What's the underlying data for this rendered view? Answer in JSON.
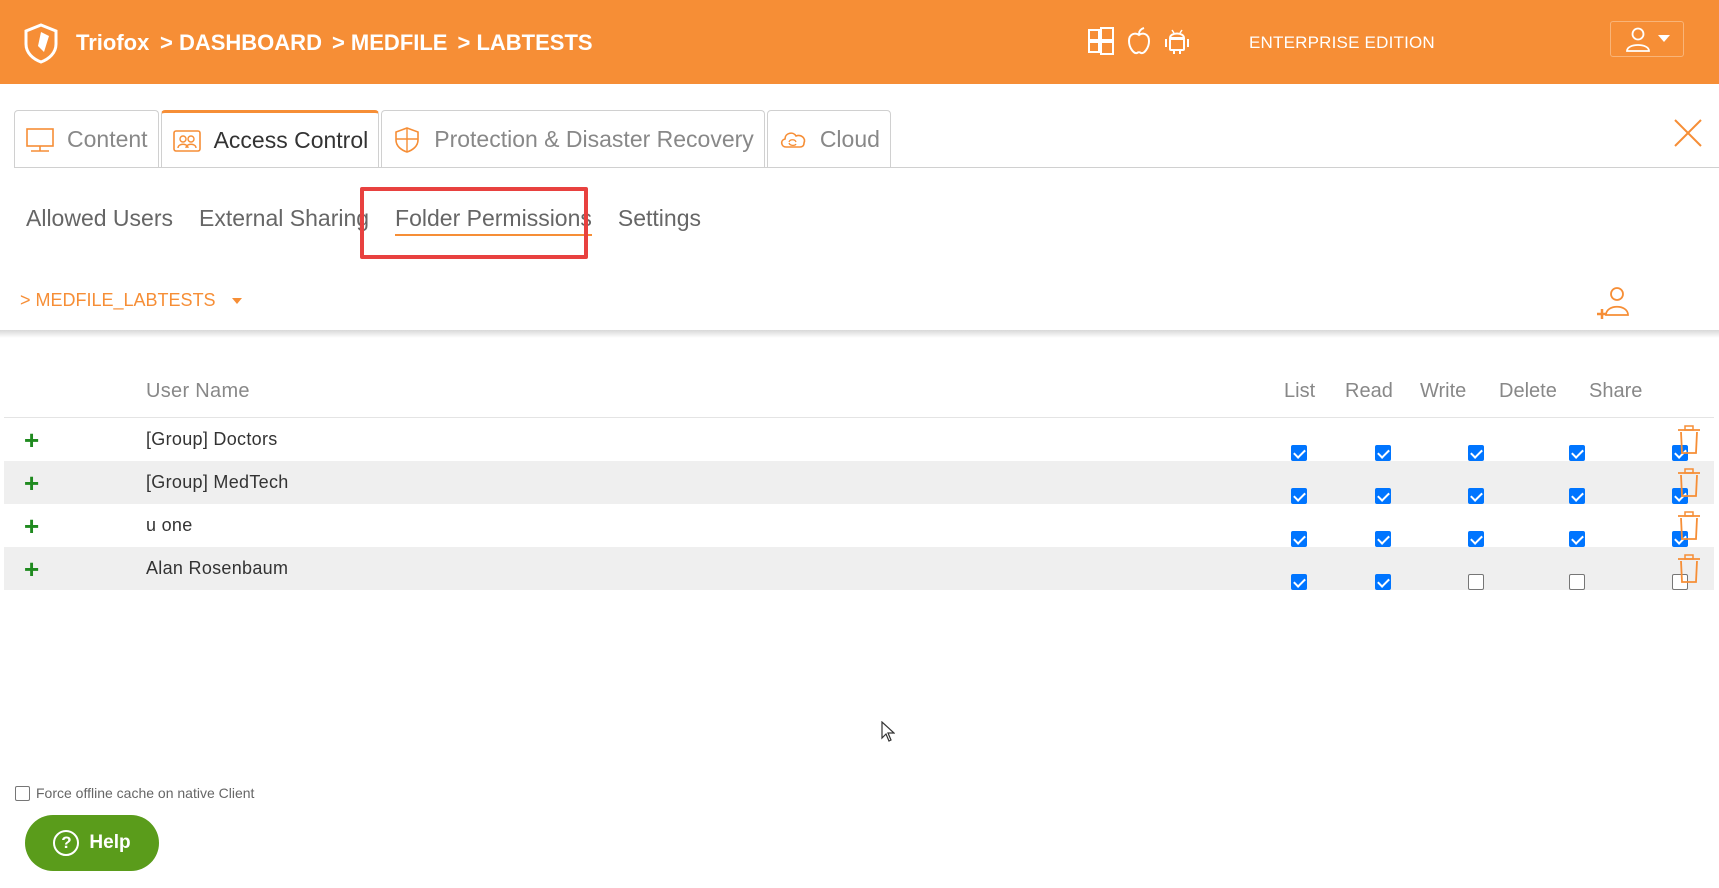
{
  "header": {
    "brand": "Triofox",
    "breadcrumb": [
      "> DASHBOARD",
      "> MEDFILE",
      "> LABTESTS"
    ],
    "platform_icons": [
      "windows-icon",
      "apple-icon",
      "android-icon"
    ],
    "edition": "ENTERPRISE EDITION",
    "accent_color": "#f68e36"
  },
  "tabs": [
    {
      "label": "Content",
      "icon": "monitor-icon",
      "active": false
    },
    {
      "label": "Access Control",
      "icon": "users-icon",
      "active": true
    },
    {
      "label": "Protection & Disaster Recovery",
      "icon": "shield-icon",
      "active": false
    },
    {
      "label": "Cloud",
      "icon": "cloud-sync-icon",
      "active": false
    }
  ],
  "subtabs": [
    {
      "label": "Allowed Users",
      "active": false
    },
    {
      "label": "External Sharing",
      "active": false
    },
    {
      "label": "Folder Permissions",
      "active": true
    },
    {
      "label": "Settings",
      "active": false
    }
  ],
  "folder_path": "> MEDFILE_LABTESTS",
  "table": {
    "columns": {
      "name": "User Name",
      "list": "List",
      "read": "Read",
      "write": "Write",
      "delete": "Delete",
      "share": "Share"
    },
    "rows": [
      {
        "name": "[Group] Doctors",
        "list": true,
        "read": true,
        "write": true,
        "delete": true,
        "share": true
      },
      {
        "name": "[Group] MedTech",
        "list": true,
        "read": true,
        "write": true,
        "delete": true,
        "share": true
      },
      {
        "name": "u one",
        "list": true,
        "read": true,
        "write": true,
        "delete": true,
        "share": true
      },
      {
        "name": "Alan Rosenbaum",
        "list": true,
        "read": true,
        "write": false,
        "delete": false,
        "share": false
      }
    ]
  },
  "footer": {
    "offline_label": "Force offline cache on native Client",
    "offline_checked": false,
    "help_label": "Help"
  }
}
